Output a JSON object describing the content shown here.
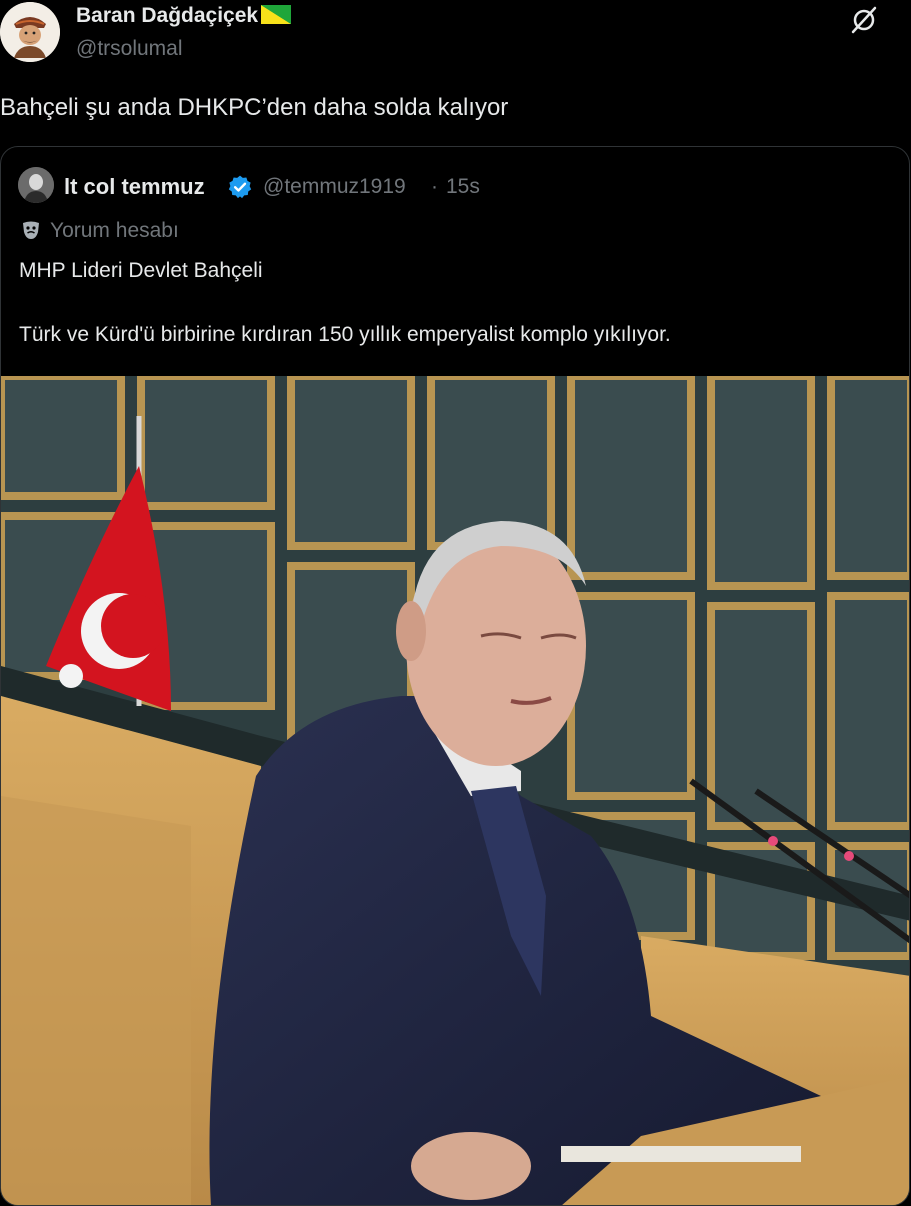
{
  "tweet": {
    "author_name": "Baran Dağdaçiçek",
    "author_handle": "@trsolumal",
    "text": "Bahçeli şu anda DHKPC’den daha solda kalıyor"
  },
  "quoted": {
    "author_name": "lt col temmuz",
    "author_handle": "@temmuz1919",
    "separator": "·",
    "time": "15s",
    "account_label": "Yorum hesabı",
    "text_line1": "MHP Lideri Devlet Bahçeli",
    "text_line2": "Türk ve Kürd'ü birbirine kırdıran 150 yıllık emperyalist komplo yıkılıyor."
  },
  "icons": {
    "flag": "flag-icon",
    "grok": "grok-icon",
    "verified": "verified-badge-icon",
    "mask": "theater-mask-icon"
  },
  "colors": {
    "background": "#000000",
    "text_primary": "#e7e9ea",
    "text_secondary": "#71767b",
    "border": "#2f3336",
    "verified": "#1d9bf0"
  }
}
